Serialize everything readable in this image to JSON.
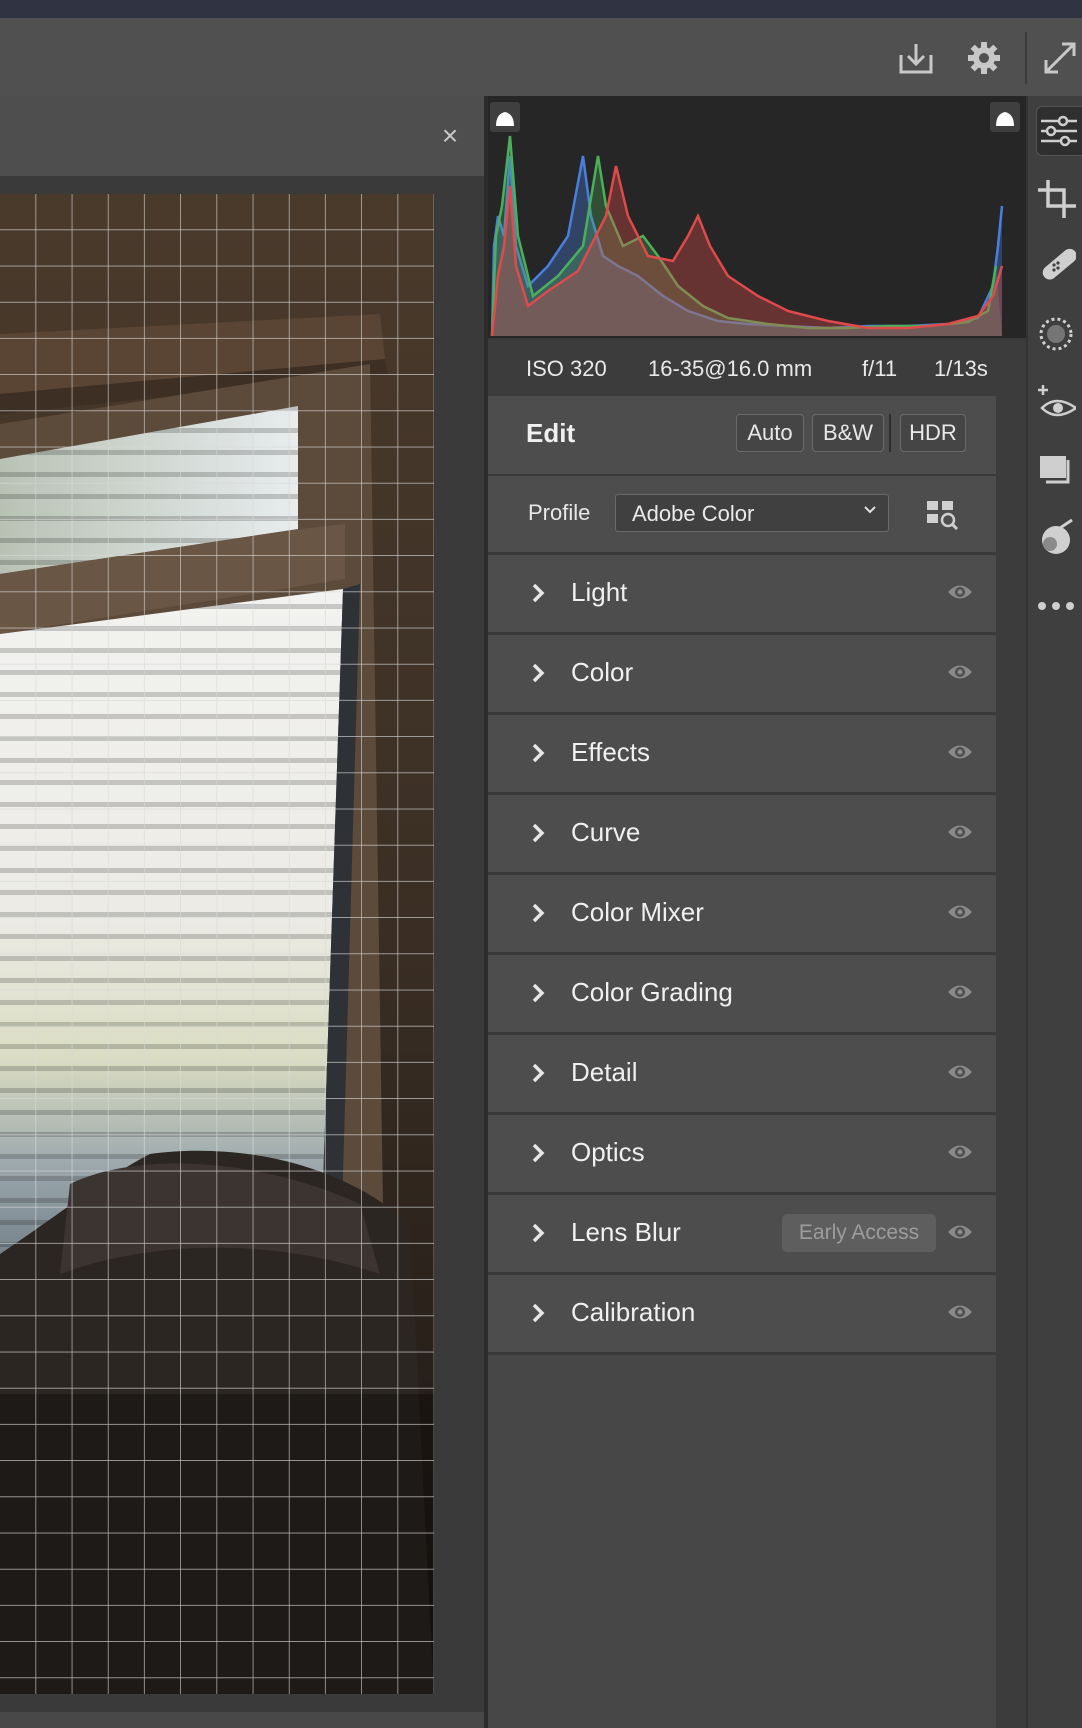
{
  "toolbar": {
    "icons": [
      "save-download-icon",
      "settings-gear-icon",
      "fullscreen-icon"
    ]
  },
  "histogram": {
    "icons": [
      "shadow-clipping-icon",
      "highlight-clipping-icon"
    ]
  },
  "info": {
    "iso": "ISO 320",
    "lens": "16-35@16.0 mm",
    "aperture": "f/11",
    "shutter": "1/13s"
  },
  "edit": {
    "title": "Edit",
    "auto_label": "Auto",
    "bw_label": "B&W",
    "hdr_label": "HDR"
  },
  "profile": {
    "label": "Profile",
    "selected": "Adobe Color"
  },
  "sections": [
    {
      "label": "Light",
      "badge": ""
    },
    {
      "label": "Color",
      "badge": ""
    },
    {
      "label": "Effects",
      "badge": ""
    },
    {
      "label": "Curve",
      "badge": ""
    },
    {
      "label": "Color Mixer",
      "badge": ""
    },
    {
      "label": "Color Grading",
      "badge": ""
    },
    {
      "label": "Detail",
      "badge": ""
    },
    {
      "label": "Optics",
      "badge": ""
    },
    {
      "label": "Lens Blur",
      "badge": "Early Access"
    },
    {
      "label": "Calibration",
      "badge": ""
    }
  ],
  "rail": {
    "icons": [
      "edit-sliders-icon",
      "crop-icon",
      "healing-bandage-icon",
      "masking-icon",
      "red-eye-icon",
      "presets-icon",
      "snapshots-icon",
      "more-icon"
    ]
  },
  "colors": {
    "panel": "#4d4d4d",
    "divider": "#3a3a3a",
    "histogram_bg": "#262626",
    "red": "#e04a4a",
    "green": "#4caf5a",
    "blue": "#4a7fe0"
  }
}
